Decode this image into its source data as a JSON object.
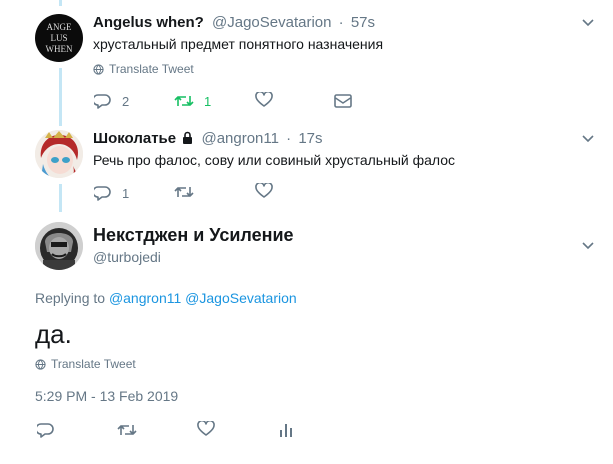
{
  "tweets": [
    {
      "display_name": "Angelus when?",
      "handle": "@JagoSevatarion",
      "time": "57s",
      "text": "хрустальный предмет понятного назначения",
      "translate_label": "Translate Tweet",
      "avatar_text": [
        "ANGE",
        "LUS",
        "WHEN"
      ],
      "replies": "2",
      "retweets": "1"
    },
    {
      "display_name": "Шоколатье",
      "handle": "@angron11",
      "time": "17s",
      "text": "Речь про фалос, сову или совиный хрустальный фалос",
      "replies": "1"
    }
  ],
  "main_tweet": {
    "display_name": "Некстджен и Усиление",
    "handle": "@turbojedi",
    "replying_to_label": "Replying to",
    "replying_to_1": "@angron11",
    "replying_to_2": "@JagoSevatarion",
    "text": "да.",
    "translate_label": "Translate Tweet",
    "timestamp": "5:29 PM - 13 Feb 2019"
  },
  "colors": {
    "link": "#1b95e0",
    "muted": "#657786",
    "retweet_active": "#17bf63",
    "thread_line": "#c4e6f5"
  }
}
